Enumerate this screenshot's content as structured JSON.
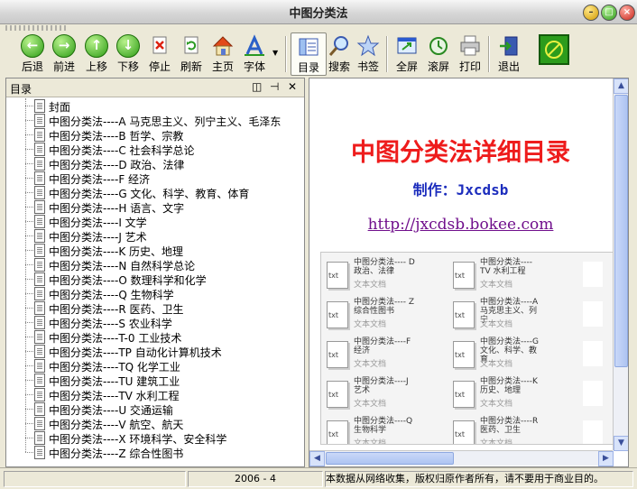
{
  "window": {
    "title": "中图分类法"
  },
  "toolbar": {
    "buttons": [
      {
        "label": "后退",
        "icon": "back-arrow-icon"
      },
      {
        "label": "前进",
        "icon": "forward-arrow-icon"
      },
      {
        "label": "上移",
        "icon": "up-arrow-icon"
      },
      {
        "label": "下移",
        "icon": "down-arrow-icon"
      },
      {
        "label": "停止",
        "icon": "stop-icon"
      },
      {
        "label": "刷新",
        "icon": "refresh-icon"
      },
      {
        "label": "主页",
        "icon": "home-icon"
      },
      {
        "label": "字体",
        "icon": "font-icon"
      },
      {
        "label": "目录",
        "icon": "contents-icon"
      },
      {
        "label": "搜索",
        "icon": "search-icon"
      },
      {
        "label": "书签",
        "icon": "bookmark-icon"
      },
      {
        "label": "全屏",
        "icon": "fullscreen-icon"
      },
      {
        "label": "滚屏",
        "icon": "scroll-icon"
      },
      {
        "label": "打印",
        "icon": "print-icon"
      },
      {
        "label": "退出",
        "icon": "exit-icon"
      }
    ]
  },
  "contents_pane": {
    "title": "目录",
    "items": [
      "封面",
      "中图分类法----A 马克思主义、列宁主义、毛泽东",
      "中图分类法----B 哲学、宗教",
      "中图分类法----C 社会科学总论",
      "中图分类法----D 政治、法律",
      "中图分类法----F 经济",
      "中图分类法----G 文化、科学、教育、体育",
      "中图分类法----H 语言、文字",
      "中图分类法----I 文学",
      "中图分类法----J 艺术",
      "中图分类法----K 历史、地理",
      "中图分类法----N 自然科学总论",
      "中图分类法----O 数理科学和化学",
      "中图分类法----Q 生物科学",
      "中图分类法----R 医药、卫生",
      "中图分类法----S 农业科学",
      "中图分类法----T-0 工业技术",
      "中图分类法----TP 自动化计算机技术",
      "中图分类法----TQ 化学工业",
      "中图分类法----TU 建筑工业",
      "中图分类法----TV 水利工程",
      "中图分类法----U 交通运输",
      "中图分类法----V 航空、航天",
      "中图分类法----X 环境科学、安全科学",
      "中图分类法----Z 综合性图书"
    ]
  },
  "content": {
    "heading": "中图分类法详细目录",
    "maker": "制作：Jxcdsb",
    "url": "http://jxcdsb.bokee.com",
    "icon_label": "txt",
    "files": [
      {
        "name": "中图分类法---- D 政治、法律",
        "type": "文本文档"
      },
      {
        "name": "中图分类法---- TV 水利工程",
        "type": "文本文档"
      },
      {
        "name": "中图分类法---- Z 综合性图书",
        "type": "文本文档"
      },
      {
        "name": "中图分类法----A 马克思主义、列宁...",
        "type": "文本文档"
      },
      {
        "name": "中图分类法----F 经济",
        "type": "文本文档"
      },
      {
        "name": "中图分类法----G 文化、科学、教育...",
        "type": "文本文档"
      },
      {
        "name": "中图分类法----J 艺术",
        "type": "文本文档"
      },
      {
        "name": "中图分类法----K 历史、地理",
        "type": "文本文档"
      },
      {
        "name": "中图分类法----Q 生物科学",
        "type": "文本文档"
      },
      {
        "name": "中图分类法----R 医药、卫生",
        "type": "文本文档"
      }
    ]
  },
  "status": {
    "date": "2006 - 4",
    "notice": "本数据从网络收集，版权归原作者所有，请不要用于商业目的。"
  },
  "colors": {
    "heading": "#ee1c1c",
    "maker": "#1c2dbd",
    "url": "#700f8c"
  }
}
